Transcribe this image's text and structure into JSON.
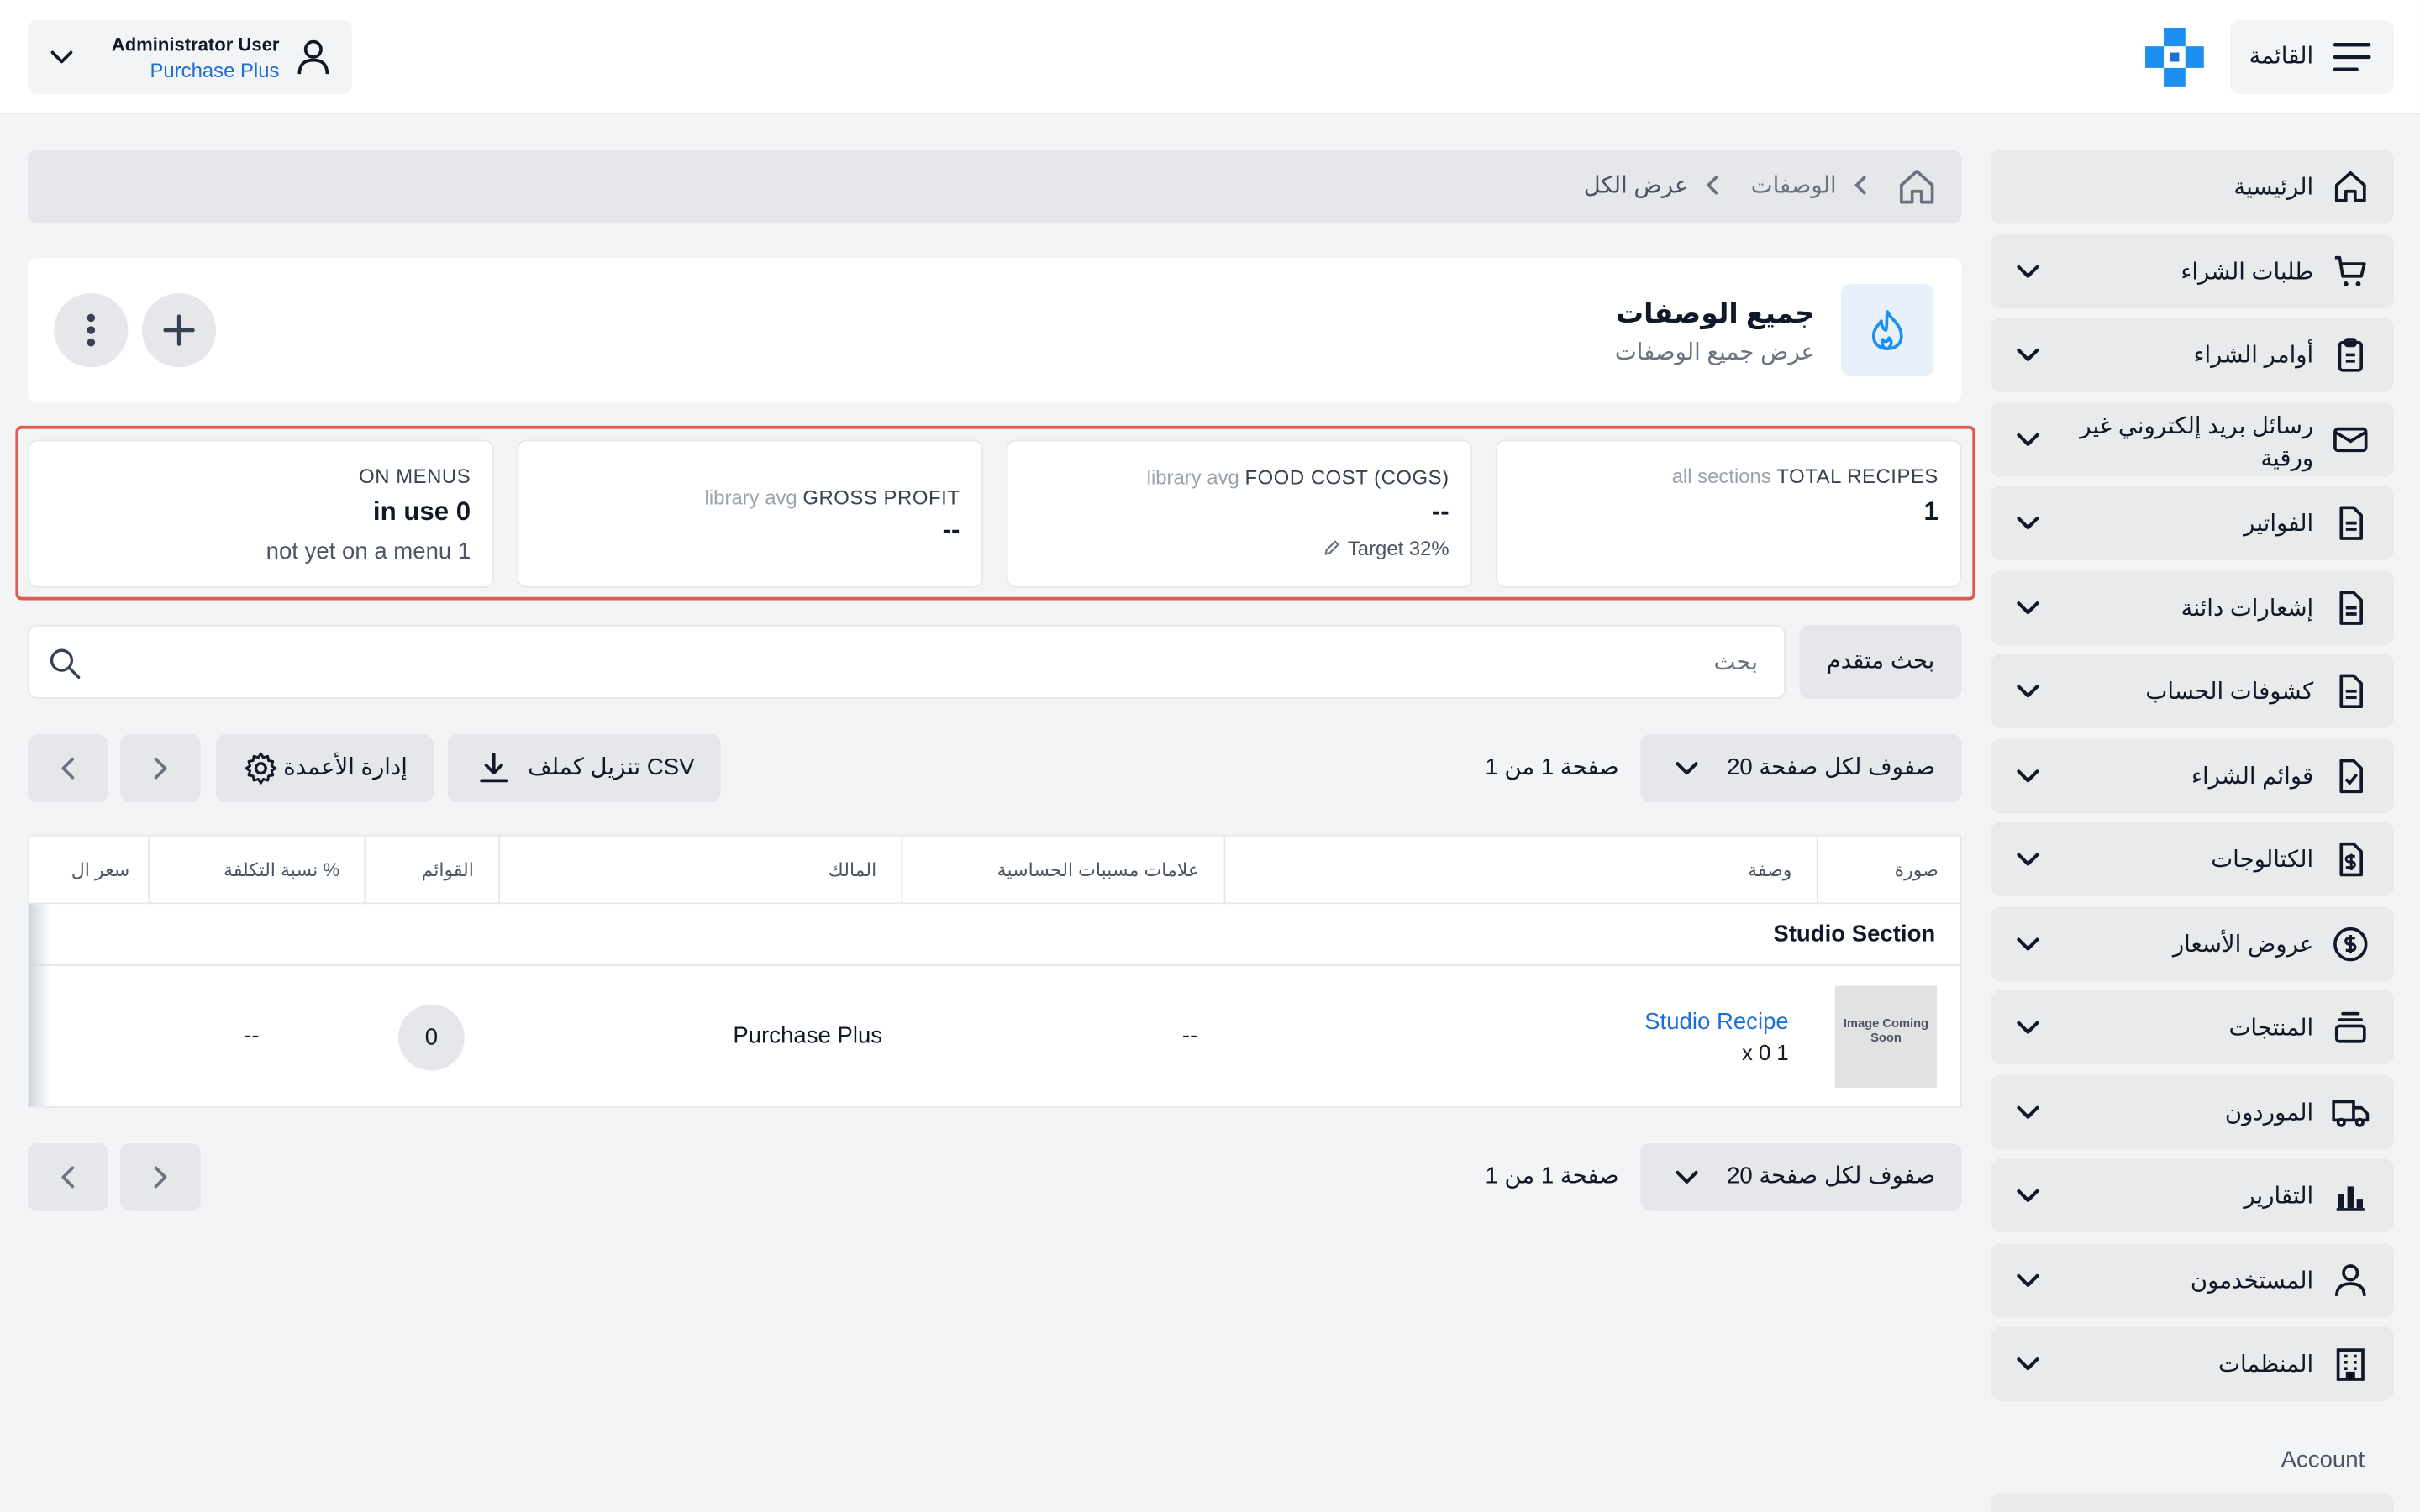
{
  "topbar": {
    "user_name": "Administrator User",
    "org_name": "Purchase Plus",
    "menu_label": "القائمة"
  },
  "sidebar": {
    "items": [
      {
        "label": "الرئيسية",
        "icon": "home-icon"
      },
      {
        "label": "طلبات الشراء",
        "icon": "cart-icon"
      },
      {
        "label": "أوامر الشراء",
        "icon": "clipboard-icon"
      },
      {
        "label": "رسائل بريد إلكتروني غير ورقية",
        "icon": "mail-icon"
      },
      {
        "label": "الفواتير",
        "icon": "document-icon"
      },
      {
        "label": "إشعارات دائنة",
        "icon": "document-icon"
      },
      {
        "label": "كشوفات الحساب",
        "icon": "document-icon"
      },
      {
        "label": "قوائم الشراء",
        "icon": "checklist-icon"
      },
      {
        "label": "الكتالوجات",
        "icon": "dollar-doc-icon"
      },
      {
        "label": "عروض الأسعار",
        "icon": "dollar-circle-icon"
      },
      {
        "label": "المنتجات",
        "icon": "stack-icon"
      },
      {
        "label": "الموردون",
        "icon": "truck-icon"
      },
      {
        "label": "التقارير",
        "icon": "bar-chart-icon"
      },
      {
        "label": "المستخدمون",
        "icon": "user-icon"
      },
      {
        "label": "المنظمات",
        "icon": "building-icon"
      }
    ],
    "account_label": "Account"
  },
  "breadcrumb": {
    "items": [
      "الوصفات",
      "عرض الكل"
    ]
  },
  "header": {
    "title": "جميع الوصفات",
    "subtitle": "عرض جميع الوصفات"
  },
  "stats": [
    {
      "key": "TOTAL RECIPES",
      "meta": "all sections",
      "value": "1",
      "note": ""
    },
    {
      "key": "FOOD COST (COGS)",
      "meta": "library avg",
      "value": "--",
      "note": "Target 32%"
    },
    {
      "key": "GROSS PROFIT",
      "meta": "library avg",
      "value": "--",
      "note": ""
    },
    {
      "key": "ON MENUS",
      "meta": "",
      "value": "in use 0",
      "note": "not yet on a menu 1"
    }
  ],
  "search": {
    "placeholder": "بحث",
    "advanced_label": "بحث متقدم"
  },
  "toolbar": {
    "rows_per_page": "20 صفوف لكل صفحة",
    "page_info": "صفحة 1 من 1",
    "download_csv": "تنزيل كملف CSV",
    "manage_columns": "إدارة الأعمدة"
  },
  "table": {
    "columns": [
      "صورة",
      "وصفة",
      "علامات مسببات الحساسية",
      "المالك",
      "القوائم",
      "نسبة التكلفة %",
      "سعر ال"
    ],
    "section": "Studio Section",
    "row": {
      "image_text": "Image Coming Soon",
      "recipe_name": "Studio Recipe",
      "recipe_qty": "x 0 1",
      "allergens": "--",
      "owner": "Purchase Plus",
      "menus": "0",
      "cost_pct": "--"
    }
  },
  "colors": {
    "accent": "#1d6fd8",
    "highlight_frame": "#e05a4e",
    "panel": "#e9eaec"
  }
}
